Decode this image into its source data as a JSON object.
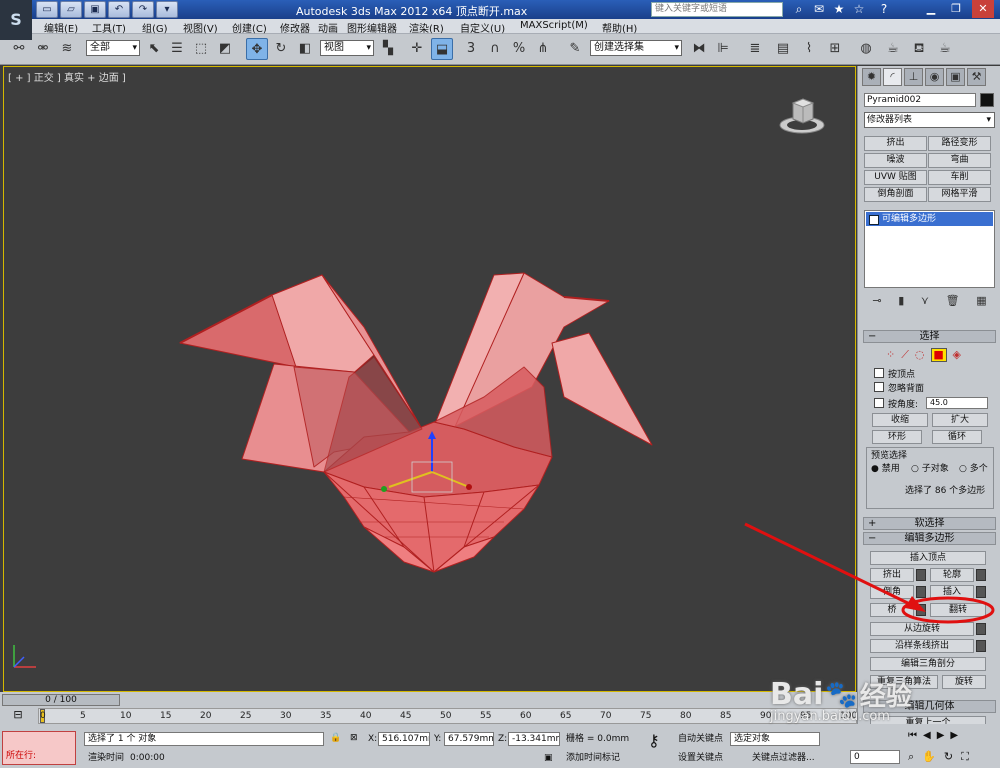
{
  "app": {
    "title": "Autodesk 3ds Max  2012 x64      顶点断开.max",
    "search_placeholder": "键入关键字或短语",
    "app_icon": "3ds-max-logo-icon"
  },
  "menu": [
    "编辑(E)",
    "工具(T)",
    "组(G)",
    "视图(V)",
    "创建(C)",
    "修改器",
    "动画",
    "图形编辑器",
    "渲染(R)",
    "自定义(U)",
    "MAXScript(M)",
    "帮助(H)"
  ],
  "toolbar": {
    "selection_filter": "全部",
    "reference_coord": "视图",
    "named_selection": "创建选择集"
  },
  "viewport": {
    "label": "[ + ] 正交 ] 真实 + 边面 ]",
    "object_color": "#e8585a"
  },
  "command_panel": {
    "object_name": "Pyramid002",
    "modifier_list": "修改器列表",
    "modifier_buttons": [
      "挤出",
      "路径变形",
      "噪波",
      "弯曲",
      "UVW 贴图",
      "车削",
      "倒角剖面",
      "网格平滑"
    ],
    "stack_item": "可编辑多边形",
    "selection": {
      "header": "选择",
      "by_vertex": "按顶点",
      "ignore_backface": "忽略背面",
      "by_angle": "按角度:",
      "angle_value": "45.0",
      "shrink": "收缩",
      "grow": "扩大",
      "ring": "环形",
      "loop": "循环",
      "preview_header": "预览选择",
      "preview_disabled": "禁用",
      "preview_subobject": "子对象",
      "preview_multi": "多个",
      "status": "选择了 86 个多边形"
    },
    "soft_selection": "软选择",
    "edit_polygons": {
      "header": "编辑多边形",
      "insert_vertex": "插入顶点",
      "extrude": "挤出",
      "outline": "轮廓",
      "bevel": "倒角",
      "inset": "插入",
      "bridge": "桥",
      "flip": "翻转",
      "hinge_from_edge": "从边旋转",
      "extrude_along_spline": "沿样条线挤出",
      "edit_triangulation": "编辑三角剖分",
      "retriangulate": "重复三角算法",
      "turn": "旋转",
      "geometry": "编辑几何体",
      "repeat_last": "重复上一个"
    }
  },
  "timeline": {
    "slider": "0 / 100",
    "ticks": [
      "0",
      "5",
      "10",
      "15",
      "20",
      "25",
      "30",
      "35",
      "40",
      "45",
      "50",
      "55",
      "60",
      "65",
      "70",
      "75",
      "80",
      "85",
      "90",
      "95",
      "100"
    ]
  },
  "status": {
    "script_line": "所在行:",
    "selected": "选择了 1 个 对象",
    "render_time_label": "渲染时间",
    "render_time": "0:00:00",
    "x_label": "X:",
    "x_value": "516.107mm",
    "y_label": "Y:",
    "y_value": "67.579mm",
    "z_label": "Z:",
    "z_value": "-13.341mm",
    "grid": "栅格 = 0.0mm",
    "add_time_tag": "添加时间标记",
    "auto_key": "自动关键点",
    "set_key": "设置关键点",
    "selected_obj": "选定对象",
    "key_filter": "关键点过滤器...",
    "frame": "0"
  },
  "watermark": {
    "brand": "Bai",
    "brand2": "经验",
    "url": "jingyan.baidu.com"
  }
}
